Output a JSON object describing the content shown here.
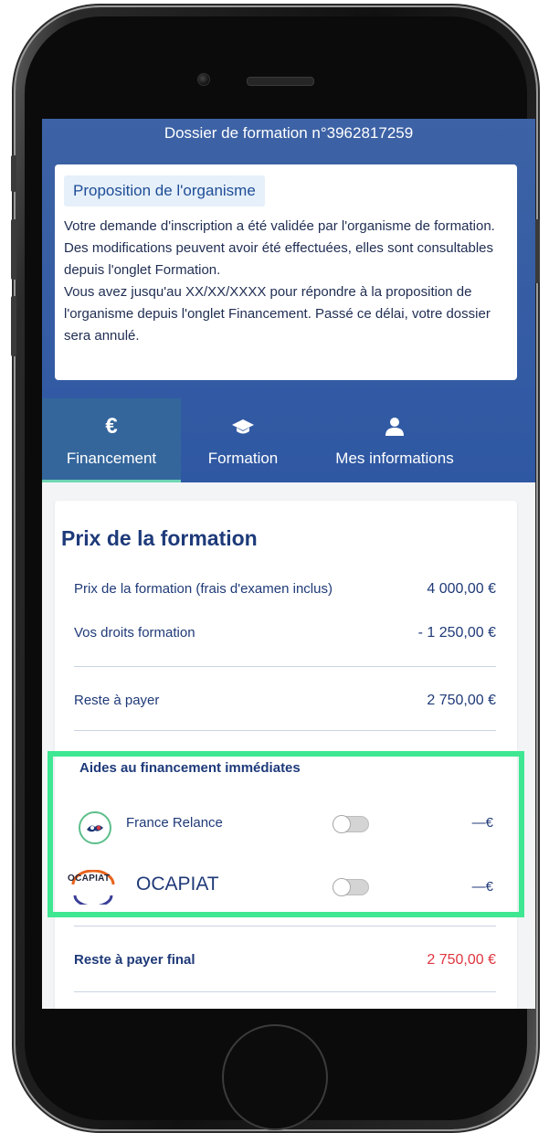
{
  "header": {
    "dossier_title": "Dossier de formation n°3962817259"
  },
  "proposal": {
    "chip_label": "Proposition de l'organisme",
    "paragraph_1": "Votre demande d'inscription a été validée par l'organisme de formation. Des modifications peuvent avoir été effectuées, elles sont consultables depuis l'onglet Formation.",
    "paragraph_2": "Vous avez jusqu'au XX/XX/XXXX pour répondre à la proposition de l'organisme depuis l'onglet Financement. Passé ce délai, votre dossier sera annulé."
  },
  "tabs": [
    {
      "label": "Financement",
      "icon": "euro-icon",
      "active": true
    },
    {
      "label": "Formation",
      "icon": "graduation-cap-icon",
      "active": false
    },
    {
      "label": "Mes informations",
      "icon": "user-icon",
      "active": false
    }
  ],
  "price": {
    "title": "Prix de la formation",
    "rows": [
      {
        "label": "Prix de la formation (frais d'examen inclus)",
        "value": "4 000,00 €"
      },
      {
        "label": "Vos droits formation",
        "value": "- 1 250,00 €"
      },
      {
        "label": "Reste à payer",
        "value": "2 750,00 €"
      }
    ]
  },
  "aides": {
    "title": "Aides au financement immédiates",
    "items": [
      {
        "label": "France Relance",
        "value": "—€",
        "toggle_on": false,
        "logo": "france-relance-logo"
      },
      {
        "label": "OCAPIAT",
        "logo_text": "OCAPIAT",
        "value": "—€",
        "toggle_on": false,
        "logo": "ocapiat-logo"
      }
    ]
  },
  "final": {
    "label": "Reste à payer final",
    "value": "2 750,00 €"
  },
  "colors": {
    "header_blue": "#2f58a3",
    "highlight_green": "#3fe793",
    "final_red": "#e0353f"
  }
}
